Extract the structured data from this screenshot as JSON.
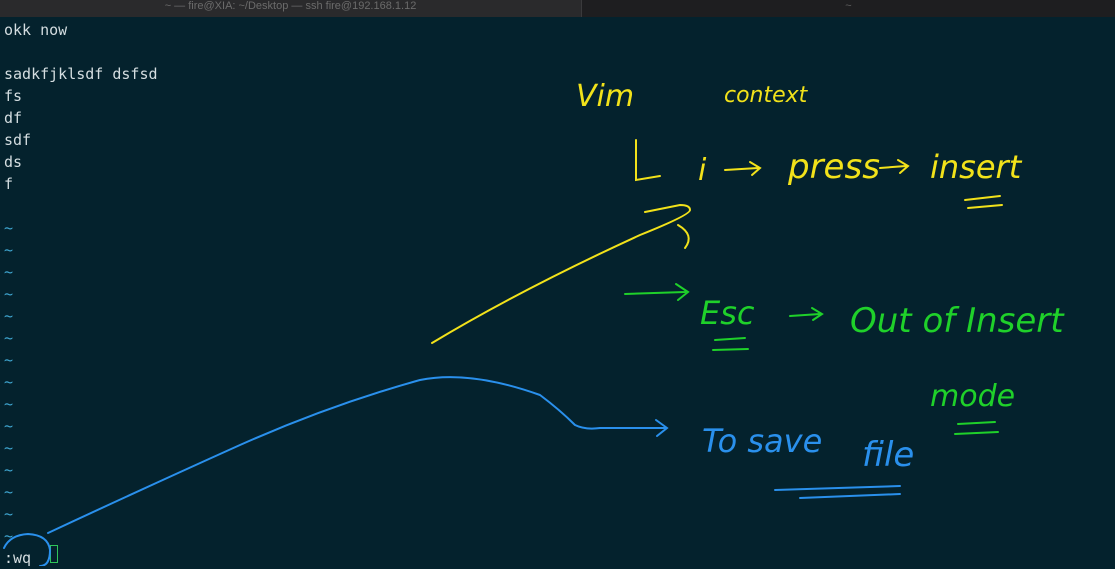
{
  "window": {
    "tab_active_title": "~ — fire@XIA: ~/Desktop — ssh fire@192.168.1.12",
    "tab_inactive_title": "~"
  },
  "terminal": {
    "lines": [
      "okk now",
      "",
      "sadkfjklsdf dsfsd",
      "fs",
      "df",
      "sdf",
      "ds",
      "f"
    ],
    "tilde": "~",
    "command": ":wq"
  },
  "annotations": {
    "vim": "Vim",
    "context": "context",
    "press_i": "i",
    "press": "press",
    "insert": "insert",
    "esc": "Esc",
    "out_of_insert": "Out of Insert",
    "mode": "mode",
    "to_save": "To save",
    "file": "file",
    "colors": {
      "yellow": "#f2e21a",
      "green": "#1fd12a",
      "blue": "#2a90ec"
    }
  }
}
